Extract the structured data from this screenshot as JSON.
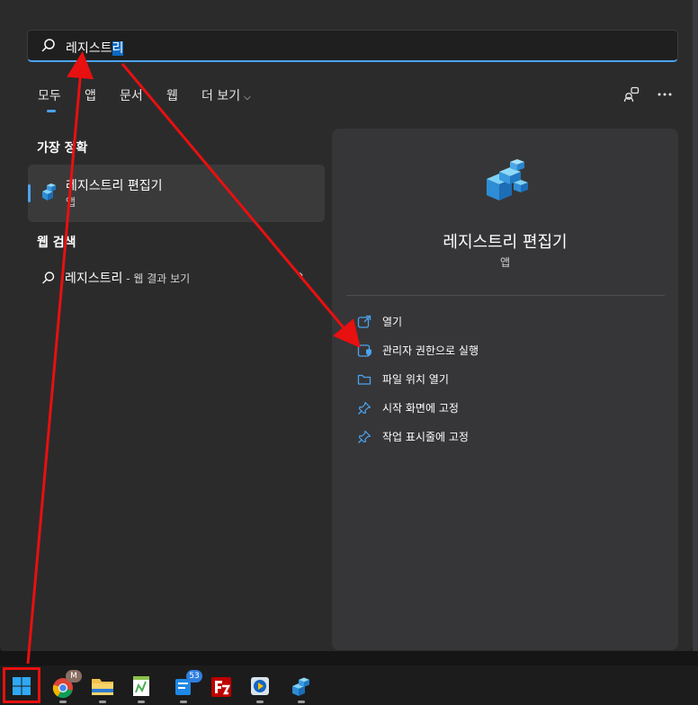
{
  "search": {
    "query_prefix": "레지스트",
    "query_selected": "리"
  },
  "filters": [
    {
      "label": "모두",
      "active": true
    },
    {
      "label": "앱",
      "active": false
    },
    {
      "label": "문서",
      "active": false
    },
    {
      "label": "웹",
      "active": false
    },
    {
      "label": "더 보기",
      "active": false
    }
  ],
  "best_match": {
    "section_title": "가장 정확",
    "title": "레지스트리 편집기",
    "subtitle": "앱"
  },
  "web_search": {
    "section_title": "웹 검색",
    "query": "레지스트리",
    "suffix": " - 웹 결과 보기"
  },
  "detail": {
    "title": "레지스트리 편집기",
    "subtitle": "앱",
    "actions": [
      {
        "label": "열기",
        "icon": "open-icon"
      },
      {
        "label": "관리자 권한으로 실행",
        "icon": "admin-shield-icon"
      },
      {
        "label": "파일 위치 열기",
        "icon": "folder-icon"
      },
      {
        "label": "시작 화면에 고정",
        "icon": "pin-icon"
      },
      {
        "label": "작업 표시줄에 고정",
        "icon": "pin-icon"
      }
    ]
  },
  "taskbar": {
    "chrome_badge": "M",
    "notification_count": "53"
  },
  "colors": {
    "accent": "#4aa3f0",
    "annotation_red": "#e81010",
    "panel_bg": "#2b2b2c",
    "detail_bg": "#363638"
  }
}
